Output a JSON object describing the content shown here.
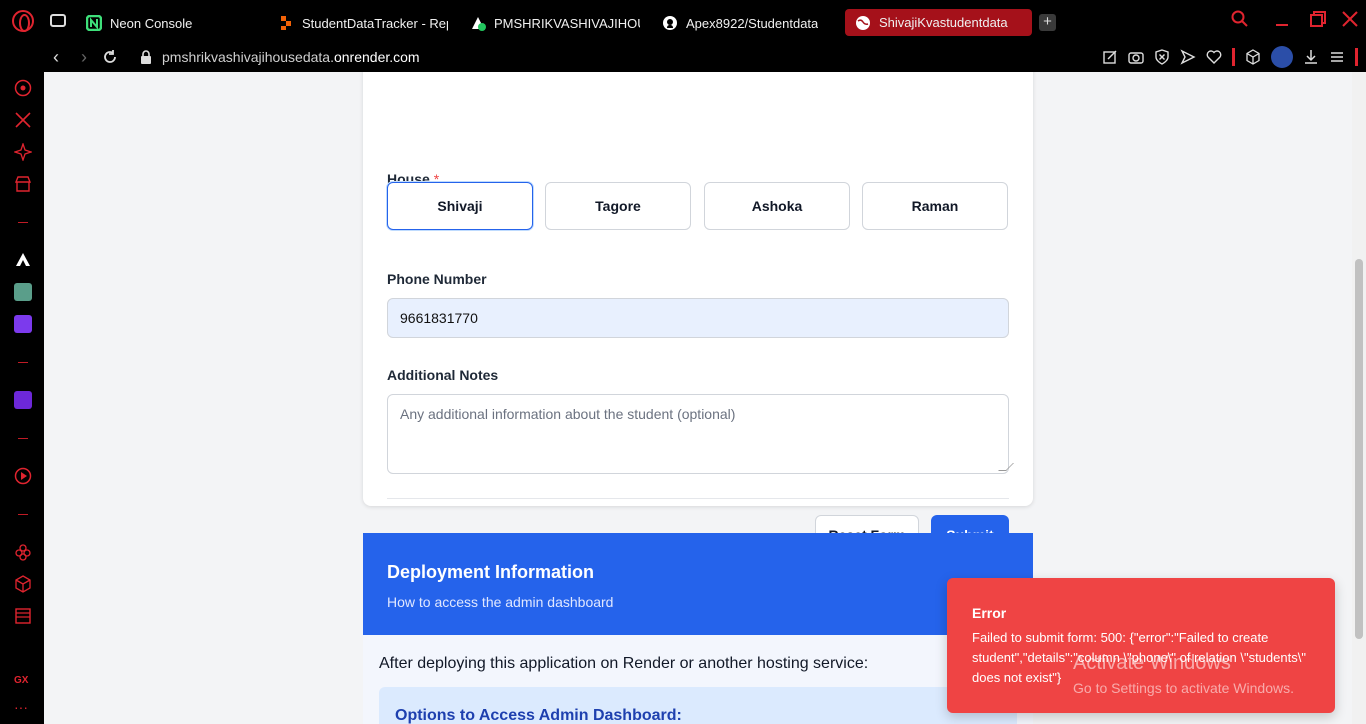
{
  "browser": {
    "tabs": [
      {
        "title": "Neon Console",
        "icon": "neon-icon",
        "active": false
      },
      {
        "title": "StudentDataTracker - Rep",
        "icon": "replit-icon",
        "active": false
      },
      {
        "title": "PMSHRIKVASHIVAJIHOUS",
        "icon": "render-icon",
        "active": false
      },
      {
        "title": "Apex8922/Studentdata",
        "icon": "github-icon",
        "active": false
      },
      {
        "title": "ShivajiKvastudentdata",
        "icon": "globe-icon",
        "active": true
      }
    ],
    "url_prefix": "pmshrikvashivajihousedata.",
    "url_domain": "onrender.com"
  },
  "form": {
    "house_label": "House",
    "required_mark": "*",
    "houses": [
      "Shivaji",
      "Tagore",
      "Ashoka",
      "Raman"
    ],
    "selected_house": "Shivaji",
    "phone_label": "Phone Number",
    "phone_value": "9661831770",
    "notes_label": "Additional Notes",
    "notes_placeholder": "Any additional information about the student (optional)",
    "reset_label": "Reset Form",
    "submit_label": "Submit"
  },
  "deployment": {
    "title": "Deployment Information",
    "subtitle": "How to access the admin dashboard",
    "body_text": "After deploying this application on Render or another hosting service:",
    "options_title": "Options to Access Admin Dashboard:"
  },
  "toast": {
    "title": "Error",
    "message": "Failed to submit form: 500: {\"error\":\"Failed to create student\",\"details\":\"column \\\"phone\\\" of relation \\\"students\\\" does not exist\"}"
  },
  "watermark": {
    "line1": "Activate Windows",
    "line2": "Go to Settings to activate Windows."
  },
  "colors": {
    "accent": "#2563eb",
    "error": "#ef4444",
    "browser_accent": "#e0242f"
  }
}
